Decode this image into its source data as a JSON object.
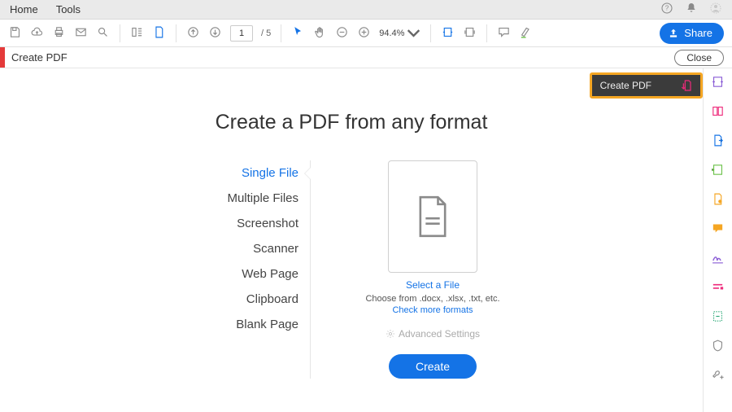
{
  "menubar": {
    "items": [
      "Home",
      "Tools"
    ]
  },
  "toolbar": {
    "page_current": "1",
    "page_total": "/ 5",
    "zoom": "94.4%",
    "share_label": "Share"
  },
  "subbar": {
    "title": "Create PDF",
    "close_label": "Close"
  },
  "callout": {
    "label": "Create PDF"
  },
  "headline": "Create a PDF from any format",
  "sources": {
    "items": [
      "Single File",
      "Multiple Files",
      "Screenshot",
      "Scanner",
      "Web Page",
      "Clipboard",
      "Blank Page"
    ],
    "selected": 0
  },
  "drop": {
    "select_label": "Select a File",
    "choose_label": "Choose from .docx, .xlsx, .txt, etc.",
    "more_label": "Check more formats",
    "advanced_label": "Advanced Settings",
    "create_label": "Create"
  }
}
